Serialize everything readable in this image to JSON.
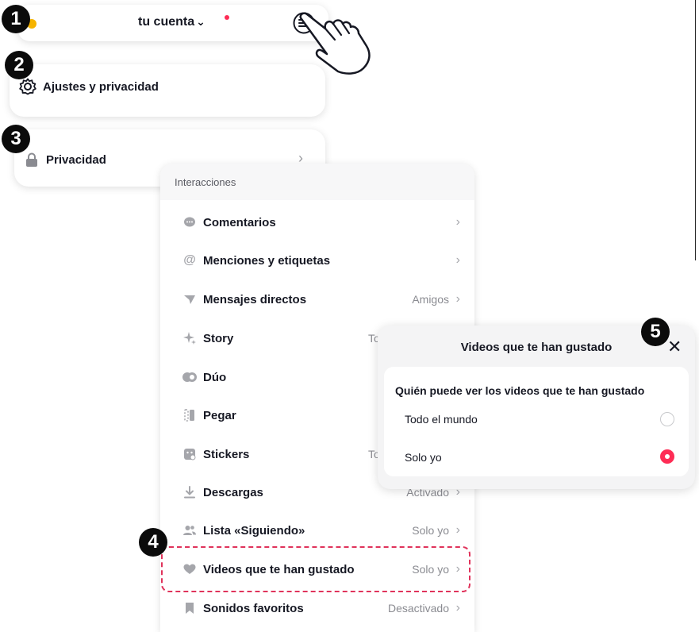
{
  "steps": [
    "1",
    "2",
    "3",
    "4",
    "5"
  ],
  "account": {
    "title": "tu cuenta",
    "chevron": "⌄"
  },
  "settings": {
    "label": "Ajustes y privacidad",
    "icon": "gear-icon"
  },
  "privacy": {
    "label": "Privacidad",
    "icon": "lock-icon",
    "chevron": "›"
  },
  "interactions": {
    "header": "Interacciones",
    "rows": [
      {
        "label": "Comentarios",
        "value": "",
        "icon": "comment-icon"
      },
      {
        "label": "Menciones y etiquetas",
        "value": "",
        "icon": "at-icon"
      },
      {
        "label": "Mensajes directos",
        "value": "Amigos",
        "icon": "send-icon"
      },
      {
        "label": "Story",
        "value": "To",
        "icon": "sparkle-icon"
      },
      {
        "label": "Dúo",
        "value": "",
        "icon": "duet-icon"
      },
      {
        "label": "Pegar",
        "value": "",
        "icon": "stitch-icon"
      },
      {
        "label": "Stickers",
        "value": "To",
        "icon": "sticker-icon"
      },
      {
        "label": "Descargas",
        "value": "Activado",
        "icon": "download-icon"
      },
      {
        "label": "Lista «Siguiendo»",
        "value": "Solo yo",
        "icon": "people-icon"
      },
      {
        "label": "Videos que te han gustado",
        "value": "Solo yo",
        "icon": "heart-icon"
      },
      {
        "label": "Sonidos favoritos",
        "value": "Desactivado",
        "icon": "bookmark-icon"
      }
    ],
    "chevron": "›"
  },
  "popup": {
    "title": "Videos que te han gustado",
    "close": "✕",
    "question": "Quién puede ver los videos que te han gustado",
    "options": [
      {
        "label": "Todo el mundo",
        "selected": false
      },
      {
        "label": "Solo yo",
        "selected": true
      }
    ]
  },
  "colors": {
    "accent": "#fe2c55",
    "highlight": "#e0335b",
    "text": "#161823",
    "muted": "#8a8b91"
  }
}
